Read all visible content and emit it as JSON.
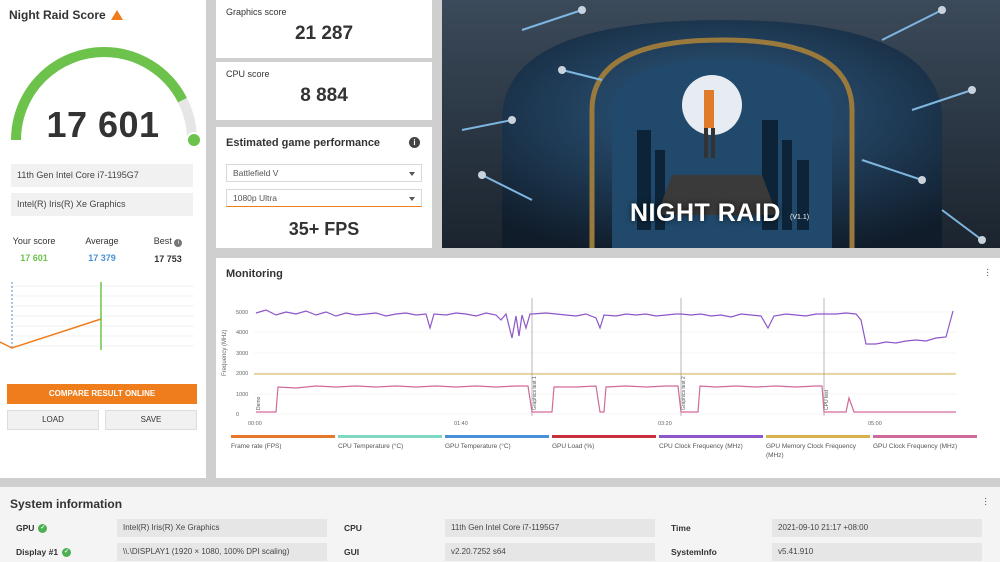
{
  "score_panel": {
    "title": "Night Raid Score",
    "score": "17 601",
    "score_fraction": 0.85,
    "cpu_name": "11th Gen Intel Core i7-1195G7",
    "gpu_name": "Intel(R) Iris(R) Xe Graphics",
    "your_score_label": "Your score",
    "your_score_value": "17 601",
    "average_label": "Average",
    "average_value": "17 379",
    "best_label": "Best",
    "best_value": "17 753",
    "mini_axis_label": "17500",
    "compare_button": "COMPARE RESULT ONLINE",
    "load_button": "LOAD",
    "save_button": "SAVE"
  },
  "graphics_score": {
    "label": "Graphics score",
    "value": "21 287"
  },
  "cpu_score": {
    "label": "CPU score",
    "value": "8 884"
  },
  "estimated": {
    "title": "Estimated game performance",
    "info_icon": "i",
    "game": "Battlefield V",
    "preset": "1080p Ultra",
    "fps": "35+ FPS"
  },
  "banner": {
    "title": "NIGHT RAID",
    "version": "(V1.1)"
  },
  "monitoring": {
    "title": "Monitoring",
    "y_axis_label": "Frequency (MHz)",
    "y_ticks": [
      "5000",
      "4000",
      "3000",
      "2000",
      "1000",
      "0"
    ],
    "x_ticks": [
      "00:00",
      "01:40",
      "03:20",
      "05:00"
    ],
    "markers": [
      "Demo",
      "Graphics test 1",
      "Graphics test 2",
      "CPU test"
    ],
    "legend": [
      {
        "label": "Frame rate (FPS)",
        "color": "#e8772e"
      },
      {
        "label": "CPU Temperature (°C)",
        "color": "#7fd8c4"
      },
      {
        "label": "GPU Temperature (°C)",
        "color": "#4a90d9"
      },
      {
        "label": "GPU Load (%)",
        "color": "#c8313d"
      },
      {
        "label": "CPU Clock Frequency (MHz)",
        "color": "#8e56c8"
      },
      {
        "label": "GPU Memory Clock Frequency (MHz)",
        "color": "#d6b24c"
      },
      {
        "label": "GPU Clock Frequency (MHz)",
        "color": "#d06a9a"
      }
    ]
  },
  "system_info": {
    "title": "System information",
    "gpu_label": "GPU",
    "gpu_value": "Intel(R) Iris(R) Xe Graphics",
    "display_label": "Display #1",
    "display_value": "\\\\.\\DISPLAY1 (1920 × 1080, 100% DPI scaling)",
    "cpu_label": "CPU",
    "cpu_value": "11th Gen Intel Core i7-1195G7",
    "gui_label": "GUI",
    "gui_value": "v2.20.7252 s64",
    "time_label": "Time",
    "time_value": "2021-09-10 21:17 +08:00",
    "sysinfo_label": "SystemInfo",
    "sysinfo_value": "v5.41.910"
  },
  "colors": {
    "accent": "#f07d1c",
    "gauge": "#6cc24a",
    "your_score": "#6cc24a",
    "average": "#4a90d9"
  }
}
